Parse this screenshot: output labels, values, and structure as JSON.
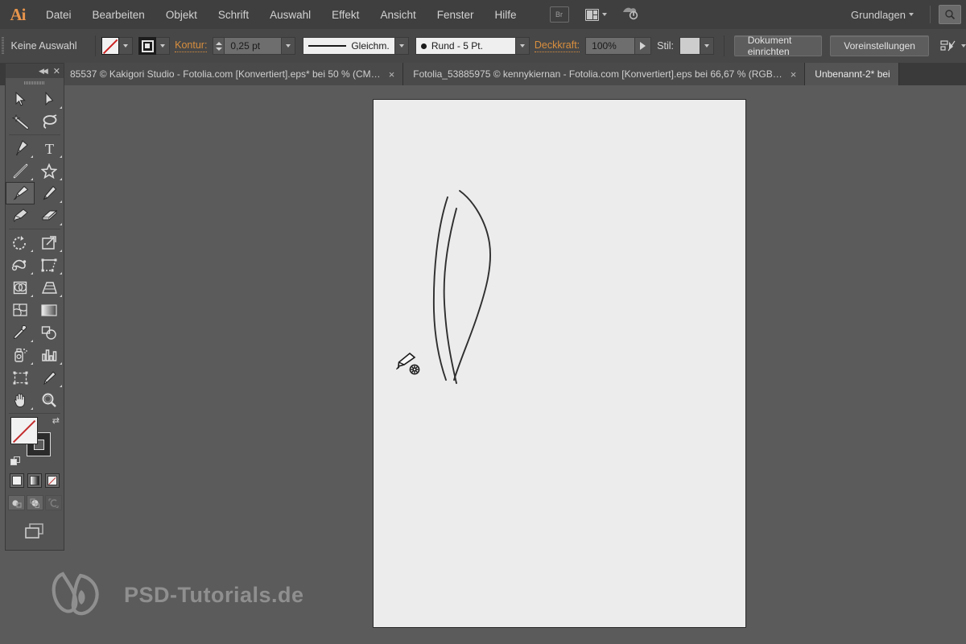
{
  "app": {
    "name": "Ai",
    "logo_color": "#e8954c"
  },
  "menubar": {
    "items": [
      {
        "label": "Datei"
      },
      {
        "label": "Bearbeiten"
      },
      {
        "label": "Objekt"
      },
      {
        "label": "Schrift"
      },
      {
        "label": "Auswahl"
      },
      {
        "label": "Effekt"
      },
      {
        "label": "Ansicht"
      },
      {
        "label": "Fenster"
      },
      {
        "label": "Hilfe"
      }
    ],
    "bridge_label": "Br",
    "arrange_icon": "arrange-documents-icon",
    "cc_icon": "creative-cloud-sync-icon",
    "workspace": "Grundlagen",
    "search_icon": "search-icon"
  },
  "controlbar": {
    "selection_status": "Keine Auswahl",
    "fill_swatch": "none",
    "stroke_swatch": "stroke-target",
    "stroke_label": "Kontur:",
    "stroke_weight": "0,25 pt",
    "stroke_profile": "Gleichm.",
    "brush_definition": "Rund - 5 Pt.",
    "opacity_label": "Deckkraft:",
    "opacity_value": "100%",
    "style_label": "Stil:",
    "document_setup_button": "Dokument einrichten",
    "preferences_button": "Voreinstellungen",
    "align_icon": "align-to-selection-icon"
  },
  "tabs": [
    {
      "title": "85537 © Kakigori Studio - Fotolia.com [Konvertiert].eps* bei 50 % (CM…",
      "close": "×",
      "active": false
    },
    {
      "title": "Fotolia_53885975 © kennykiernan - Fotolia.com [Konvertiert].eps bei 66,67 % (RGB…",
      "close": "×",
      "active": false
    },
    {
      "title": "Unbenannt-2* bei",
      "close": "",
      "active": true
    }
  ],
  "toolpanel": {
    "collapse_icon": "◀◀",
    "close_icon": "✕",
    "tools": [
      {
        "name": "selection-tool",
        "has_flyout": false
      },
      {
        "name": "direct-selection-tool",
        "has_flyout": true
      },
      {
        "name": "magic-wand-tool",
        "has_flyout": false
      },
      {
        "name": "lasso-tool",
        "has_flyout": false
      },
      {
        "name": "pen-tool",
        "has_flyout": true
      },
      {
        "name": "type-tool",
        "has_flyout": true
      },
      {
        "name": "line-segment-tool",
        "has_flyout": true
      },
      {
        "name": "shape-star-tool",
        "has_flyout": true
      },
      {
        "name": "paintbrush-tool",
        "has_flyout": false,
        "selected": true
      },
      {
        "name": "pencil-tool",
        "has_flyout": true
      },
      {
        "name": "blob-brush-tool",
        "has_flyout": false
      },
      {
        "name": "eraser-tool",
        "has_flyout": true
      },
      {
        "name": "rotate-tool",
        "has_flyout": true
      },
      {
        "name": "scale-tool",
        "has_flyout": true
      },
      {
        "name": "width-tool",
        "has_flyout": true
      },
      {
        "name": "free-transform-tool",
        "has_flyout": true
      },
      {
        "name": "shape-builder-tool",
        "has_flyout": true
      },
      {
        "name": "perspective-grid-tool",
        "has_flyout": true
      },
      {
        "name": "mesh-tool",
        "has_flyout": false
      },
      {
        "name": "gradient-tool",
        "has_flyout": false
      },
      {
        "name": "eyedropper-tool",
        "has_flyout": true
      },
      {
        "name": "blend-tool",
        "has_flyout": false
      },
      {
        "name": "symbol-sprayer-tool",
        "has_flyout": true
      },
      {
        "name": "column-graph-tool",
        "has_flyout": true
      },
      {
        "name": "artboard-tool",
        "has_flyout": false
      },
      {
        "name": "slice-tool",
        "has_flyout": true
      },
      {
        "name": "hand-tool",
        "has_flyout": true
      },
      {
        "name": "zoom-tool",
        "has_flyout": false
      }
    ],
    "fill_state": "none",
    "stroke_state": "black",
    "swap_icon": "swap-fill-stroke-icon",
    "default_icon": "default-fill-stroke-icon",
    "paint_modes": [
      {
        "name": "color-mode",
        "type": "solid"
      },
      {
        "name": "gradient-mode",
        "type": "gradient"
      },
      {
        "name": "none-mode",
        "type": "none"
      }
    ],
    "draw_modes": [
      {
        "name": "draw-normal-mode"
      },
      {
        "name": "draw-behind-mode"
      },
      {
        "name": "draw-inside-mode"
      }
    ],
    "screen_mode": "change-screen-mode-icon"
  },
  "canvas": {
    "cursor_icon": "paintbrush-cursor",
    "artboard_background": "#ececec",
    "workspace_background": "#5b5b5b",
    "strokes": [
      "M 95 130 C 82 200, 78 300, 84 355",
      "M 110 115 C 138 145, 152 185, 140 235",
      "M 104 188 C 96 250, 92 300, 97 345"
    ]
  },
  "watermark": {
    "text": "PSD-Tutorials.de",
    "logo": "butterfly-logo"
  }
}
